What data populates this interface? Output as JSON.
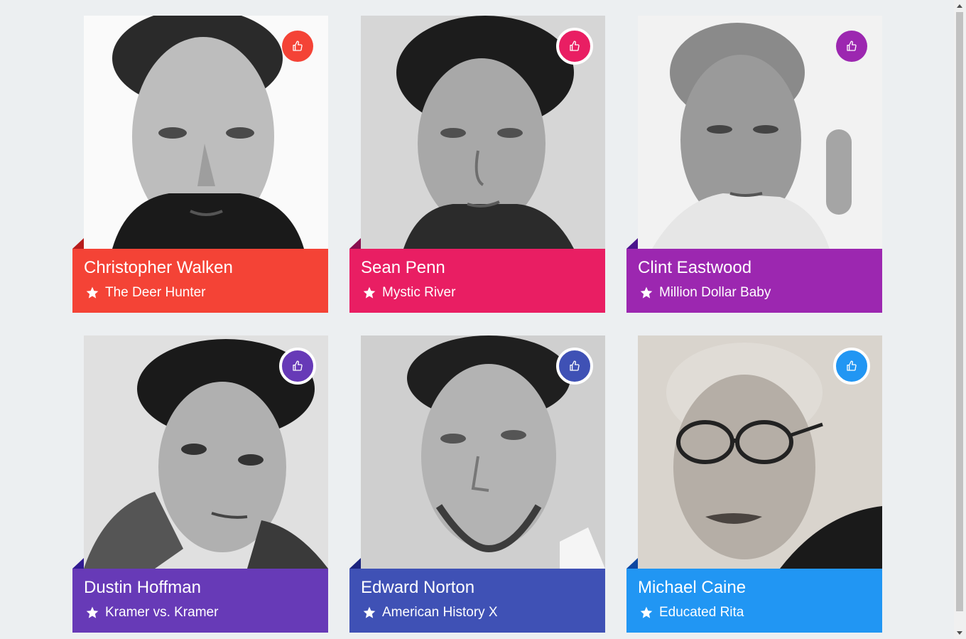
{
  "cards": [
    {
      "name": "Christopher Walken",
      "movie": "The Deer Hunter",
      "color": "#f44336",
      "fold_color": "#b71c1c",
      "like_ringed": false,
      "portrait": "christopher-walken-portrait"
    },
    {
      "name": "Sean Penn",
      "movie": "Mystic River",
      "color": "#e91e63",
      "fold_color": "#880e4f",
      "like_ringed": true,
      "portrait": "sean-penn-portrait"
    },
    {
      "name": "Clint Eastwood",
      "movie": "Million Dollar Baby",
      "color": "#9c27b0",
      "fold_color": "#4a148c",
      "like_ringed": false,
      "portrait": "clint-eastwood-portrait"
    },
    {
      "name": "Dustin Hoffman",
      "movie": "Kramer vs. Kramer",
      "color": "#673ab7",
      "fold_color": "#311b92",
      "like_ringed": true,
      "portrait": "dustin-hoffman-portrait"
    },
    {
      "name": "Edward Norton",
      "movie": "American History X",
      "color": "#3f51b5",
      "fold_color": "#1a237e",
      "like_ringed": true,
      "portrait": "edward-norton-portrait"
    },
    {
      "name": "Michael Caine",
      "movie": "Educated Rita",
      "color": "#2196f3",
      "fold_color": "#0d47a1",
      "like_ringed": true,
      "portrait": "michael-caine-portrait"
    }
  ],
  "icons": {
    "like": "thumbs-up-icon",
    "movie": "star-icon"
  },
  "colors": {
    "page_background": "#eceff1"
  }
}
